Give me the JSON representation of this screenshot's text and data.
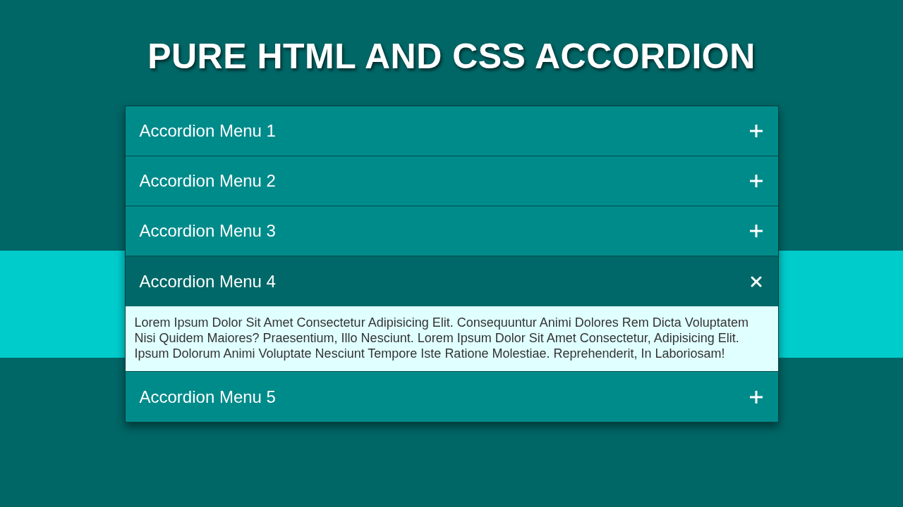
{
  "title": "PURE HTML AND CSS ACCORDION",
  "accordion": [
    {
      "label": "Accordion Menu 1",
      "expanded": false
    },
    {
      "label": "Accordion Menu 2",
      "expanded": false
    },
    {
      "label": "Accordion Menu 3",
      "expanded": false
    },
    {
      "label": "Accordion Menu 4",
      "expanded": true,
      "content": "Lorem Ipsum Dolor Sit Amet Consectetur Adipisicing Elit. Consequuntur Animi Dolores Rem Dicta Voluptatem Nisi Quidem Maiores? Praesentium, Illo Nesciunt. Lorem Ipsum Dolor Sit Amet Consectetur, Adipisicing Elit. Ipsum Dolorum Animi Voluptate Nesciunt Tempore Iste Ratione Molestiae. Reprehenderit, In Laboriosam!"
    },
    {
      "label": "Accordion Menu 5",
      "expanded": false
    }
  ]
}
